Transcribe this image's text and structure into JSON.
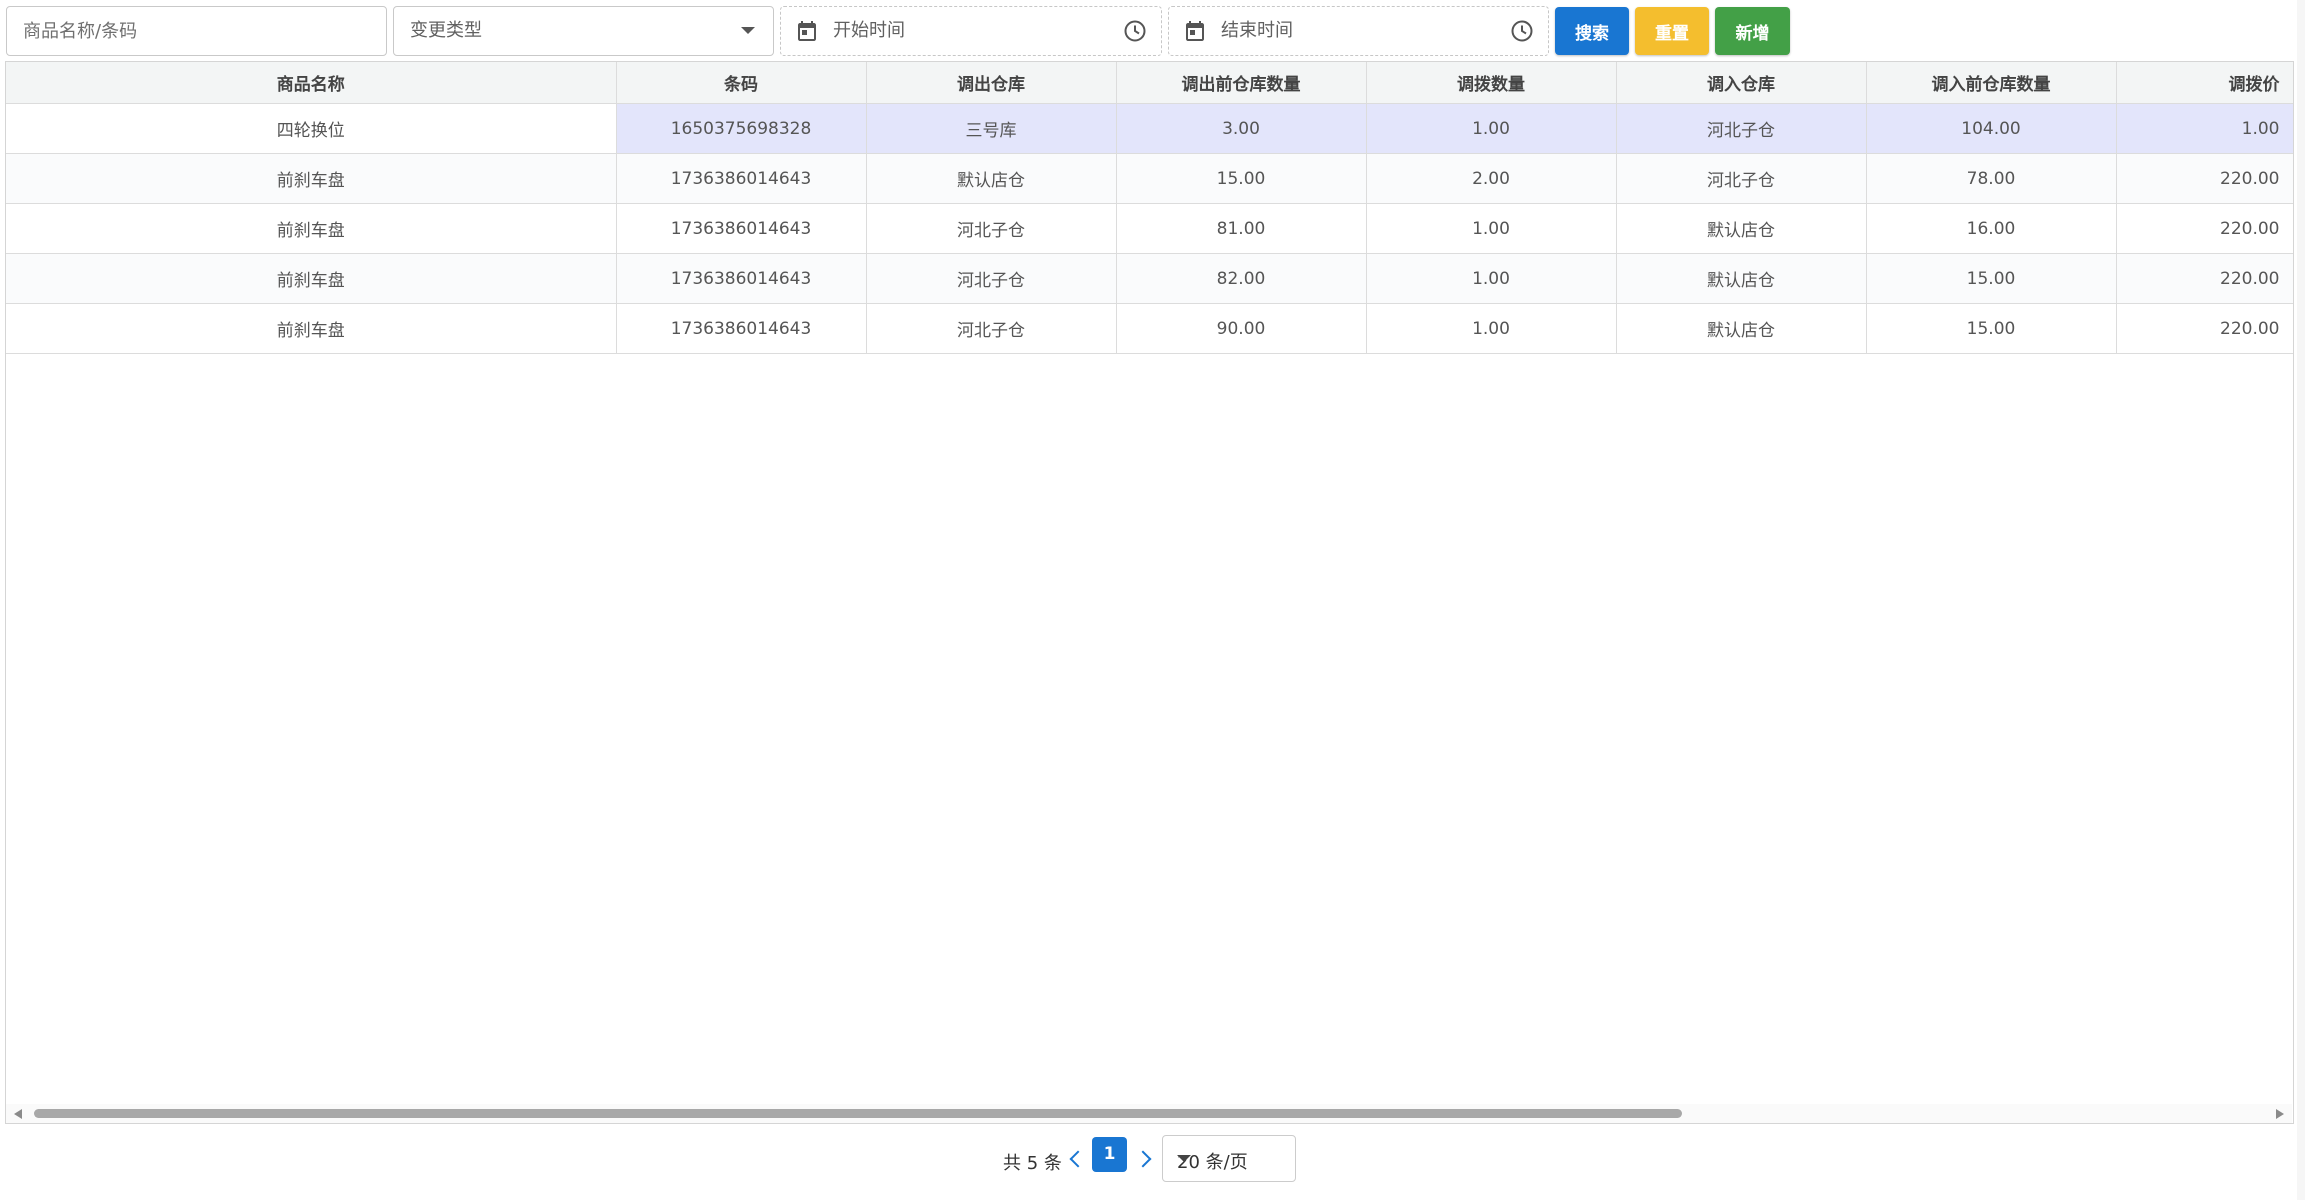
{
  "filters": {
    "name_placeholder": "商品名称/条码",
    "change_type_placeholder": "变更类型",
    "start_time_placeholder": "开始时间",
    "end_time_placeholder": "结束时间"
  },
  "buttons": {
    "search": "搜索",
    "reset": "重置",
    "add": "新增"
  },
  "colors": {
    "search": "#1976d2",
    "reset": "#f4be2e",
    "add": "#43a047",
    "selected_row": "#e3e5fb"
  },
  "icons": [
    "calendar-icon",
    "clock-icon",
    "chevron-down-icon",
    "chevron-left-icon",
    "chevron-right-icon"
  ],
  "table": {
    "columns": [
      "商品名称",
      "条码",
      "调出仓库",
      "调出前仓库数量",
      "调拨数量",
      "调入仓库",
      "调入前仓库数量",
      "调拨价"
    ],
    "rows": [
      [
        "四轮换位",
        "1650375698328",
        "三号库",
        "3.00",
        "1.00",
        "河北子仓",
        "104.00",
        "1.00"
      ],
      [
        "前刹车盘",
        "1736386014643",
        "默认店仓",
        "15.00",
        "2.00",
        "河北子仓",
        "78.00",
        "220.00"
      ],
      [
        "前刹车盘",
        "1736386014643",
        "河北子仓",
        "81.00",
        "1.00",
        "默认店仓",
        "16.00",
        "220.00"
      ],
      [
        "前刹车盘",
        "1736386014643",
        "河北子仓",
        "82.00",
        "1.00",
        "默认店仓",
        "15.00",
        "220.00"
      ],
      [
        "前刹车盘",
        "1736386014643",
        "河北子仓",
        "90.00",
        "1.00",
        "默认店仓",
        "15.00",
        "220.00"
      ]
    ]
  },
  "pagination": {
    "total": "共 5 条",
    "current_page": "1",
    "page_size": "20 条/页"
  }
}
